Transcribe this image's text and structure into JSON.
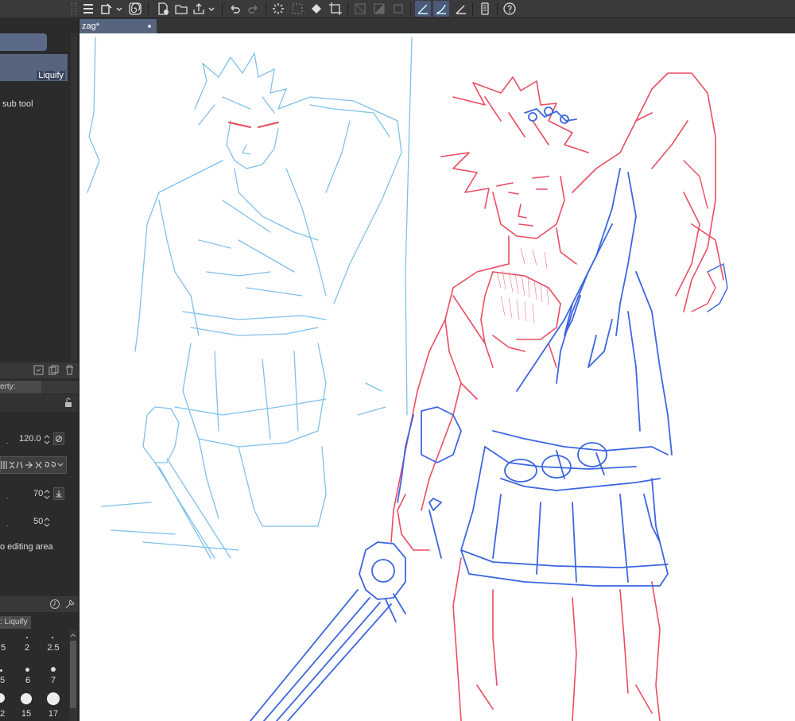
{
  "document": {
    "tab_title": "zag*"
  },
  "sub_tool": {
    "selected_label": "Liquify",
    "add_label": "sub tool"
  },
  "tool_property": {
    "title": "erty: Liquify",
    "size_value": "120.0",
    "strength_value": "70",
    "hardness_value": "50",
    "note": "o editing area"
  },
  "brush_size": {
    "title": ": Liquify",
    "row1": [
      "5",
      "2",
      "2.5"
    ],
    "row2": [
      "5",
      "6",
      "7"
    ],
    "row3": [
      "2",
      "15",
      "17"
    ]
  },
  "icons": {
    "menu": "menu-icon",
    "undo": "undo-icon",
    "redo": "redo-icon",
    "help": "help-icon"
  },
  "colors": {
    "accent": "#56647e",
    "sketch_light_blue": "#7fc1ea",
    "sketch_red": "#ea4d63",
    "sketch_blue": "#3d66e0"
  }
}
